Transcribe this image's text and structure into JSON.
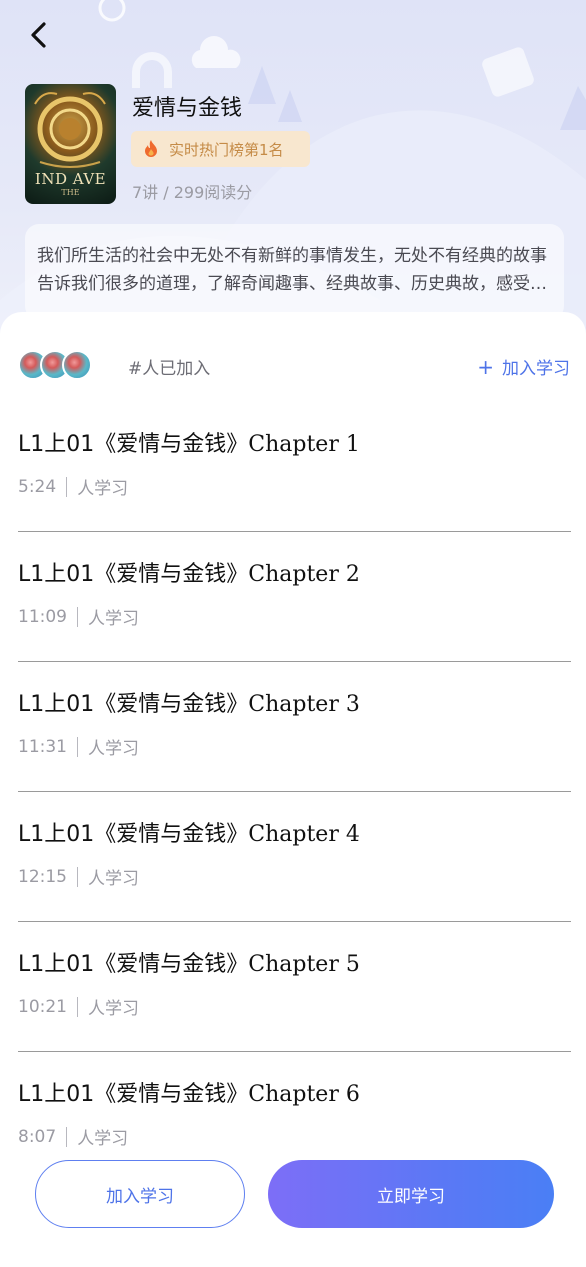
{
  "header": {
    "back_icon": "chevron-left-icon",
    "book": {
      "title": "爱情与金钱",
      "rank_label": "实时热门榜第1名",
      "rank_icon": "fire-icon",
      "meta": "7讲 / 299阅读分",
      "cover_title": "IND AVE",
      "cover_subtitle": "THE"
    },
    "description": "我们所生活的社会中无处不有新鲜的事情发生，无处不有经典的故事告诉我们很多的道理，了解奇闻趣事、经典故事、历史典故，感受生活中的点点滴滴。"
  },
  "learners": {
    "count_text": "#人已加入",
    "join_label": "加入学习",
    "join_icon": "plus-icon"
  },
  "chapters": [
    {
      "prefix": "L1上01",
      "title_cjk": "《爱情与金钱》",
      "title_en": "Chapter 1",
      "duration": "5:24",
      "learners": "人学习"
    },
    {
      "prefix": "L1上01",
      "title_cjk": "《爱情与金钱》",
      "title_en": "Chapter 2",
      "duration": "11:09",
      "learners": "人学习"
    },
    {
      "prefix": "L1上01",
      "title_cjk": "《爱情与金钱》",
      "title_en": "Chapter 3",
      "duration": "11:31",
      "learners": "人学习"
    },
    {
      "prefix": "L1上01",
      "title_cjk": "《爱情与金钱》",
      "title_en": "Chapter 4",
      "duration": "12:15",
      "learners": "人学习"
    },
    {
      "prefix": "L1上01",
      "title_cjk": "《爱情与金钱》",
      "title_en": "Chapter 5",
      "duration": "10:21",
      "learners": "人学习"
    },
    {
      "prefix": "L1上01",
      "title_cjk": "《爱情与金钱》",
      "title_en": "Chapter 6",
      "duration": "8:07",
      "learners": "人学习"
    }
  ],
  "footer": {
    "join_button": "加入学习",
    "study_button": "立即学习"
  },
  "colors": {
    "accent": "#4e73e8",
    "rank_bg": "#f8e7cf",
    "rank_text": "#c58b47",
    "gradient_start": "#7d6ef7",
    "gradient_end": "#4a7ff5"
  }
}
